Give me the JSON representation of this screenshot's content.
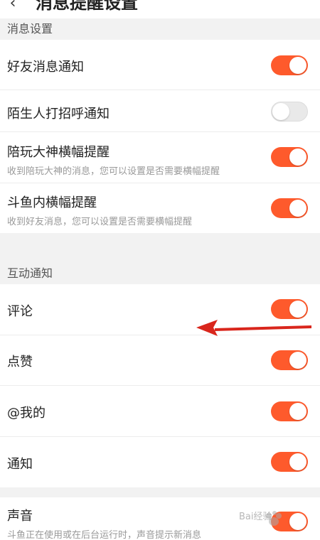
{
  "header": {
    "back_icon": "chevron-left-icon",
    "title": "消息提醒设置"
  },
  "sections": {
    "message": {
      "title": "消息设置",
      "items": [
        {
          "label": "好友消息通知",
          "sub": "",
          "on": true
        },
        {
          "label": "陌生人打招呼通知",
          "sub": "",
          "on": false
        },
        {
          "label": "陪玩大神横幅提醒",
          "sub": "收到陪玩大神的消息，您可以设置是否需要横幅提醒",
          "on": true
        },
        {
          "label": "斗鱼内横幅提醒",
          "sub": "收到好友消息，您可以设置是否需要横幅提醒",
          "on": true
        }
      ]
    },
    "interaction": {
      "title": "互动通知",
      "items": [
        {
          "label": "评论",
          "on": true
        },
        {
          "label": "点赞",
          "on": true
        },
        {
          "label": "@我的",
          "on": true
        },
        {
          "label": "通知",
          "on": true
        }
      ]
    },
    "sound": {
      "items": [
        {
          "label": "声音",
          "sub": "斗鱼正在使用或在后台运行时，声音提示新消息",
          "on": true
        }
      ]
    }
  },
  "colors": {
    "accent": "#fe5a2c",
    "toggle_off": "#e9e9e9",
    "arrow": "#d9261c"
  },
  "watermark": {
    "text": "Bai经验"
  }
}
